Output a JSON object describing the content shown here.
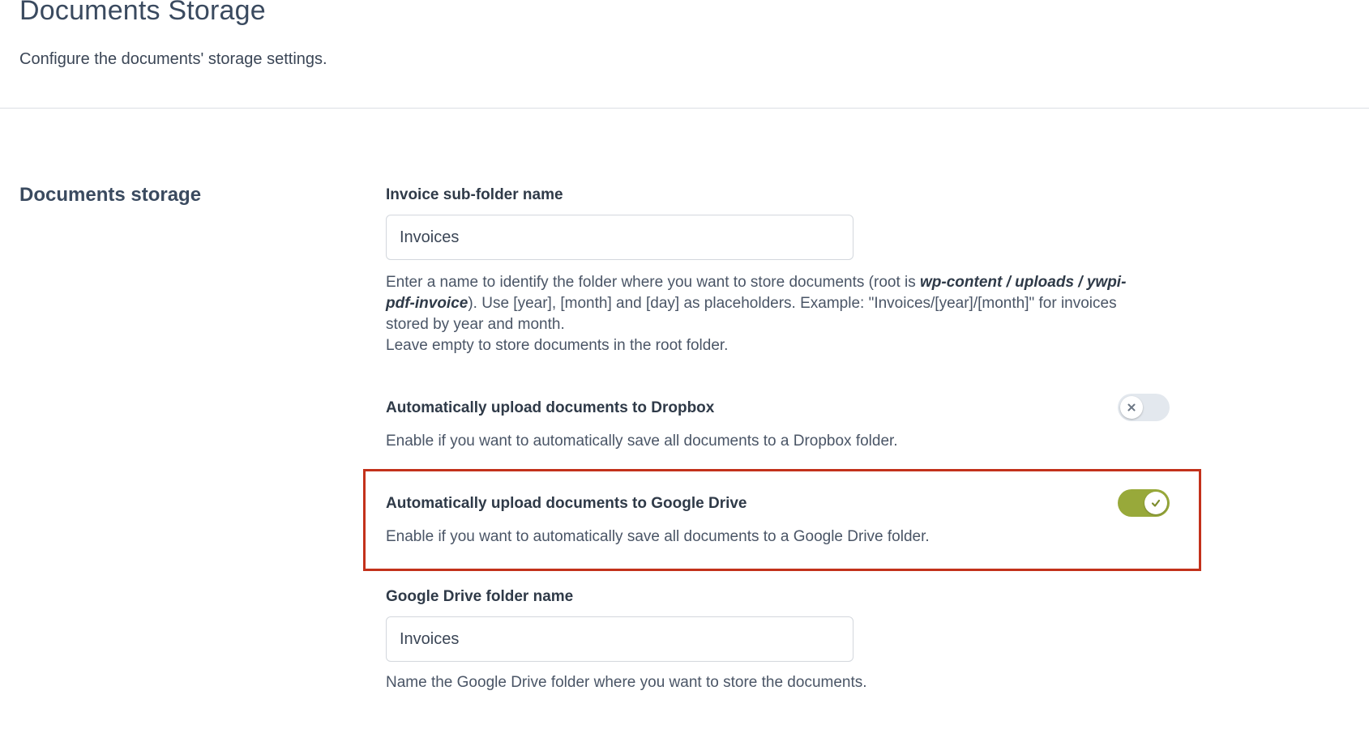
{
  "header": {
    "title": "Documents Storage",
    "subtitle": "Configure the documents' storage settings."
  },
  "section": {
    "title": "Documents storage"
  },
  "invoice_folder": {
    "label": "Invoice sub-folder name",
    "value": "Invoices",
    "help_part1": "Enter a name to identify the folder where you want to store documents (root is ",
    "help_path1": "wp-content / uploads / ywpi-",
    "help_path2": "pdf-invoice",
    "help_part2": "). Use [year], [month] and [day] as placeholders. Example: \"Invoices/[year]/[month]\" for invoices",
    "help_part3": "stored by year and month.",
    "help_part4": "Leave empty to store documents in the root folder."
  },
  "dropbox": {
    "label": "Automatically upload documents to Dropbox",
    "help": "Enable if you want to automatically save all documents to a Dropbox folder.",
    "enabled": false,
    "icon": "close-icon"
  },
  "google_drive": {
    "label": "Automatically upload documents to Google Drive",
    "help": "Enable if you want to automatically save all documents to a Google Drive folder.",
    "enabled": true,
    "icon": "check-icon"
  },
  "google_drive_folder": {
    "label": "Google Drive folder name",
    "value": "Invoices",
    "help": "Name the Google Drive folder where you want to store the documents."
  },
  "colors": {
    "toggle_on": "#98a93a",
    "toggle_off": "#e3e8ee",
    "highlight": "#c3311b"
  }
}
